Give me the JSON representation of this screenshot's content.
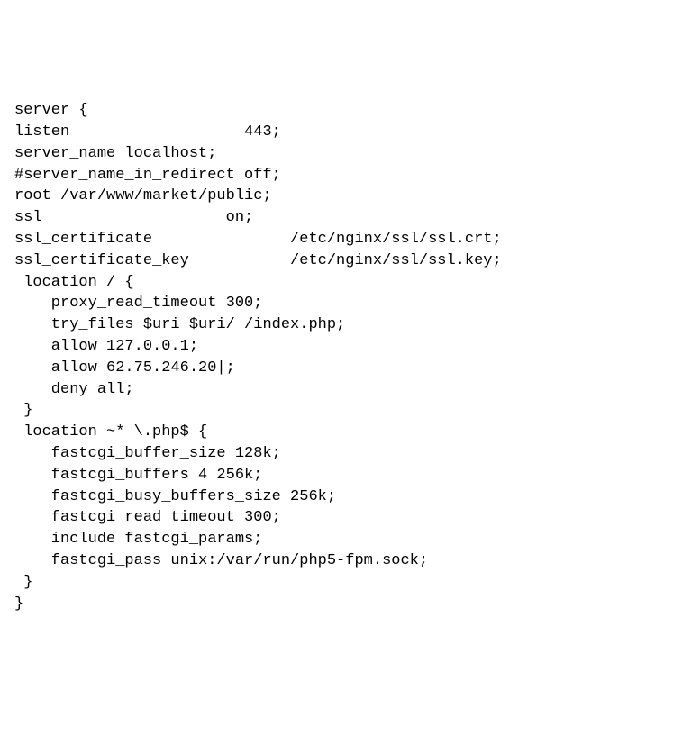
{
  "code": {
    "lines": [
      "server {",
      "listen                   443;",
      "server_name localhost;",
      "#server_name_in_redirect off;",
      "root /var/www/market/public;",
      "",
      "ssl                    on;",
      "ssl_certificate               /etc/nginx/ssl/ssl.crt;",
      "ssl_certificate_key           /etc/nginx/ssl/ssl.key;",
      "",
      " location / {",
      "    proxy_read_timeout 300;",
      "    try_files $uri $uri/ /index.php;",
      "    allow 127.0.0.1;",
      "    allow 62.75.246.20|;",
      "    deny all;",
      " }",
      "",
      " location ~* \\.php$ {",
      "    fastcgi_buffer_size 128k;",
      "    fastcgi_buffers 4 256k;",
      "    fastcgi_busy_buffers_size 256k;",
      "    fastcgi_read_timeout 300;",
      "    include fastcgi_params;",
      "    fastcgi_pass unix:/var/run/php5-fpm.sock;",
      " }",
      "",
      "",
      "}"
    ]
  }
}
